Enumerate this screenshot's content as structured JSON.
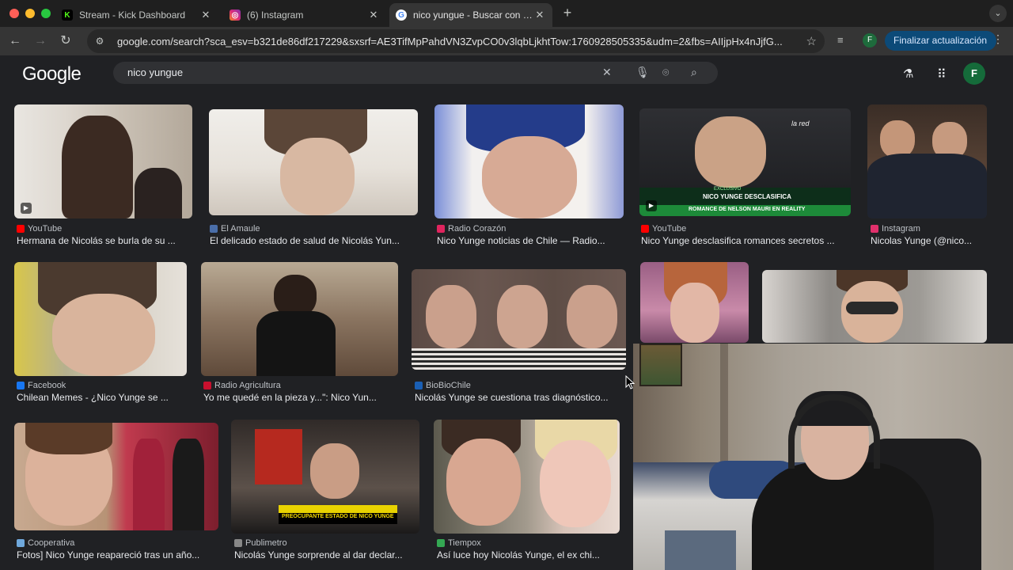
{
  "browser": {
    "tabs": [
      {
        "title": "Stream - Kick Dashboard",
        "favicon_color": "#53fc18"
      },
      {
        "title": "(6) Instagram",
        "favicon_color": "#e1306c"
      },
      {
        "title": "nico yungue - Buscar con Google",
        "favicon_color": "#4285f4"
      }
    ],
    "url": "google.com/search?sca_esv=b321de86df217229&sxsrf=AE3TifMpPahdVN3ZvpCO0v3lqbLjkhtTow:1760928505335&udm=2&fbs=AIIjpHx4nJjfG...",
    "update_label": "Finalizar actualización",
    "profile_initial": "F"
  },
  "google": {
    "logo": "Google",
    "query": "nico yungue",
    "avatar_initial": "F"
  },
  "results": [
    {
      "source": "YouTube",
      "caption": "Hermana de Nicolás se burla de su ...",
      "fav": "#ff0000",
      "video": true
    },
    {
      "source": "El Amaule",
      "caption": "El delicado estado de salud de Nicolás Yun...",
      "fav": "#4a6ea9",
      "video": false
    },
    {
      "source": "Radio Corazón",
      "caption": "Nico Yunge noticias de Chile — Radio...",
      "fav": "#e0245e",
      "video": false
    },
    {
      "source": "YouTube",
      "caption": "Nico Yunge desclasifica romances secretos ...",
      "fav": "#ff0000",
      "video": true
    },
    {
      "source": "Instagram",
      "caption": "Nicolas Yunge (@nico...",
      "fav": "#e1306c",
      "video": false
    },
    {
      "source": "Facebook",
      "caption": "Chilean Memes - ¿Nico Yunge se ...",
      "fav": "#1877f2",
      "video": false
    },
    {
      "source": "Radio Agricultura",
      "caption": "Yo me quedé en la pieza y...\": Nico Yun...",
      "fav": "#c8102e",
      "video": false
    },
    {
      "source": "BioBioChile",
      "caption": "Nicolás Yunge se cuestiona tras diagnóstico...",
      "fav": "#1a5fb4",
      "video": false
    },
    {
      "source": "Cooperativa",
      "caption": "Fotos] Nico Yunge reapareció tras un año...",
      "fav": "#6fa8dc",
      "video": false
    },
    {
      "source": "Publimetro",
      "caption": "Nicolás Yunge sorprende al dar declar...",
      "fav": "#888888",
      "video": false
    },
    {
      "source": "Tiempox",
      "caption": "Así luce hoy Nicolás Yunge, el ex chi...",
      "fav": "#34a853",
      "video": false
    }
  ],
  "overlays": {
    "news_banner_1": "NICO YUNGE DESCLASIFICA",
    "news_banner_2": "ROMANCE DE NELSON MAURI EN REALITY",
    "news_tag": "EXCLUSIVO",
    "news_banner_3": "PREOCUPANTE ESTADO DE NICO YUNGE",
    "channel_logo": "la red"
  }
}
